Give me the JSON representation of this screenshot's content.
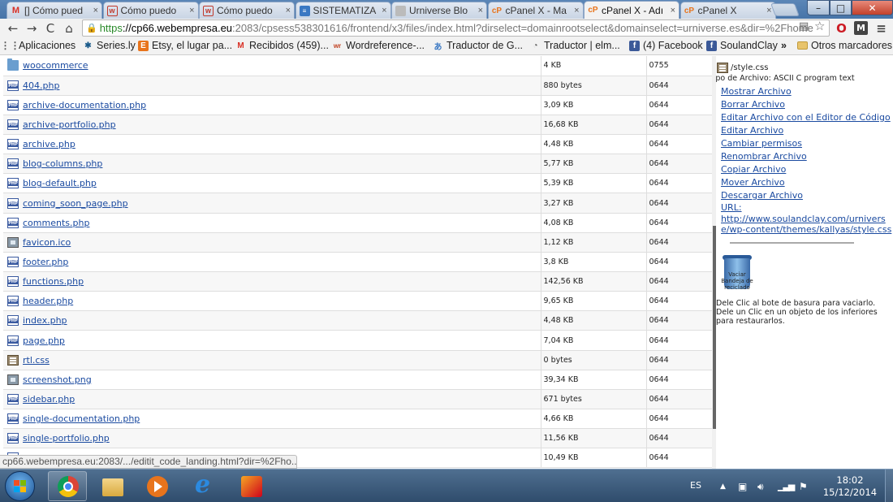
{
  "browser": {
    "tabs": [
      {
        "title": "[] Cómo pued",
        "favicon": "gmail-icon",
        "fav": "M",
        "favclass": "fav-gmail"
      },
      {
        "title": "Cómo puedo",
        "favicon": "wordreference-icon",
        "fav": "w",
        "favclass": "fav-w"
      },
      {
        "title": "Cómo puedo",
        "favicon": "wordreference-icon",
        "fav": "w",
        "favclass": "fav-w"
      },
      {
        "title": "SISTEMATIZA",
        "favicon": "document-icon",
        "fav": "≡",
        "favclass": "fav-doc"
      },
      {
        "title": "Urniverse Blo",
        "favicon": "blog-icon",
        "fav": "",
        "favclass": "fav-blog"
      },
      {
        "title": "cPanel X - Ma",
        "favicon": "cpanel-icon",
        "fav": "cP",
        "favclass": "fav-cp"
      },
      {
        "title": "cPanel X - Adı",
        "favicon": "cpanel-icon",
        "fav": "cP",
        "favclass": "fav-cp",
        "active": true
      },
      {
        "title": "cPanel X",
        "favicon": "cpanel-icon",
        "fav": "cP",
        "favclass": "fav-cp"
      }
    ],
    "close_glyph": "×",
    "window_controls": {
      "minimize": "–",
      "maximize": "□",
      "close": "✕"
    }
  },
  "toolbar": {
    "back": "←",
    "forward": "→",
    "reload": "C",
    "home": "⌂",
    "url_https": "https",
    "url_host": "://cp66.webempresa.eu",
    "url_rest": ":2083/cpsess538301616/frontend/x3/files/index.html?dirselect=domainrootselect&domainselect=urniverse.es&dir=%2Fhome",
    "menu_glyph": "≡",
    "ext_opera": "O",
    "ext_gmail": "M",
    "star_glyph": "☆",
    "doc_glyph": "▤"
  },
  "bookmarks": [
    {
      "label": "Aplicaciones",
      "ic": "⋮⋮",
      "cls": "ic-apps"
    },
    {
      "label": "Series.ly",
      "ic": "✱",
      "cls": "ic-series"
    },
    {
      "label": "Etsy, el lugar pa...",
      "ic": "E",
      "cls": "ic-etsy"
    },
    {
      "label": "Recibidos (459)...",
      "ic": "M",
      "cls": "ic-gmail"
    },
    {
      "label": "Wordreference-...",
      "ic": "wr",
      "cls": "ic-wr"
    },
    {
      "label": "Traductor de G...",
      "ic": "あ",
      "cls": "ic-gtrans"
    },
    {
      "label": "Traductor | elm...",
      "ic": "◔",
      "cls": "ic-trad"
    },
    {
      "label": "(4) Facebook",
      "ic": "f",
      "cls": "ic-fb"
    },
    {
      "label": "SoulandClay",
      "ic": "f",
      "cls": "ic-fb"
    }
  ],
  "bookmarks_more": "»",
  "bookmarks_other": "Otros marcadores",
  "files": [
    {
      "name": "woocommerce",
      "size": "4 KB",
      "perm": "0755",
      "type": "folder"
    },
    {
      "name": "404.php",
      "size": "880 bytes",
      "perm": "0644",
      "type": "php"
    },
    {
      "name": "archive-documentation.php",
      "size": "3,09 KB",
      "perm": "0644",
      "type": "php"
    },
    {
      "name": "archive-portfolio.php",
      "size": "16,68 KB",
      "perm": "0644",
      "type": "php"
    },
    {
      "name": "archive.php",
      "size": "4,48 KB",
      "perm": "0644",
      "type": "php"
    },
    {
      "name": "blog-columns.php",
      "size": "5,77 KB",
      "perm": "0644",
      "type": "php"
    },
    {
      "name": "blog-default.php",
      "size": "5,39 KB",
      "perm": "0644",
      "type": "php"
    },
    {
      "name": "coming_soon_page.php",
      "size": "3,27 KB",
      "perm": "0644",
      "type": "php"
    },
    {
      "name": "comments.php",
      "size": "4,08 KB",
      "perm": "0644",
      "type": "php"
    },
    {
      "name": "favicon.ico",
      "size": "1,12 KB",
      "perm": "0644",
      "type": "image"
    },
    {
      "name": "footer.php",
      "size": "3,8 KB",
      "perm": "0644",
      "type": "php"
    },
    {
      "name": "functions.php",
      "size": "142,56 KB",
      "perm": "0644",
      "type": "php"
    },
    {
      "name": "header.php",
      "size": "9,65 KB",
      "perm": "0644",
      "type": "php"
    },
    {
      "name": "index.php",
      "size": "4,48 KB",
      "perm": "0644",
      "type": "php"
    },
    {
      "name": "page.php",
      "size": "7,04 KB",
      "perm": "0644",
      "type": "php"
    },
    {
      "name": "rtl.css",
      "size": "0 bytes",
      "perm": "0644",
      "type": "css"
    },
    {
      "name": "screenshot.png",
      "size": "39,34 KB",
      "perm": "0644",
      "type": "image"
    },
    {
      "name": "sidebar.php",
      "size": "671 bytes",
      "perm": "0644",
      "type": "php"
    },
    {
      "name": "single-documentation.php",
      "size": "4,66 KB",
      "perm": "0644",
      "type": "php"
    },
    {
      "name": "single-portfolio.php",
      "size": "11,56 KB",
      "perm": "0644",
      "type": "php"
    },
    {
      "name": "",
      "size": "10,49 KB",
      "perm": "0644",
      "type": "php"
    }
  ],
  "sidepanel": {
    "selected_file": "/style.css",
    "file_type": "tipo de Archivo: ASCII C program text",
    "actions": [
      "Mostrar Archivo",
      "Borrar Archivo",
      "Editar Archivo con el Editor de Código",
      "Editar Archivo",
      "Cambiar permisos",
      "Renombrar Archivo",
      "Copiar Archivo",
      "Mover Archivo",
      "Descargar Archivo"
    ],
    "url_label": "URL:",
    "url_value": "http://www.soulandclay.com/urniverse/wp-content/themes/kallyas/style.css",
    "trash_label": "Vaciar Bandeja de reciclado",
    "hint": "Dele Clic al bote de basura para vaciarlo. Dele un Clic en un objeto de los inferiores para restaurarlos."
  },
  "status_bar": "cp66.webempresa.eu:2083/.../editit_code_landing.html?dir=%2Fho...",
  "taskbar": {
    "language": "ES",
    "time": "18:02",
    "date": "15/12/2014",
    "tray": {
      "up_arrow": "▲",
      "flag": "⚑"
    }
  }
}
